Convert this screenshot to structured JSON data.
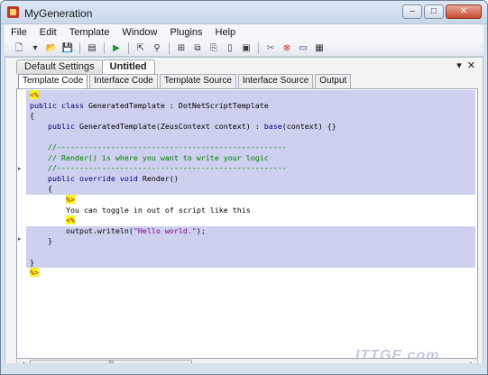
{
  "window": {
    "title": "MyGeneration",
    "min": "–",
    "max": "□",
    "close": "✕"
  },
  "menu": [
    "File",
    "Edit",
    "Template",
    "Window",
    "Plugins",
    "Help"
  ],
  "toolbar": {
    "icons": [
      "new-file-icon",
      "dropdown-arrow-icon",
      "open-folder-icon",
      "save-icon",
      "separator",
      "properties-icon",
      "separator",
      "run-icon",
      "separator",
      "open-output-icon",
      "pin-icon",
      "separator",
      "tree-icon",
      "copy-icon",
      "paste-icon",
      "document-icon",
      "code-doc-icon",
      "separator",
      "tools-icon",
      "stop-icon",
      "monitor-icon",
      "settings-doc-icon"
    ]
  },
  "doc_tabs": [
    {
      "label": "Default Settings",
      "active": false
    },
    {
      "label": "Untitled",
      "active": true
    }
  ],
  "doc_controls": {
    "dropdown": "▾",
    "close": "✕"
  },
  "sub_tabs": [
    {
      "label": "Template Code",
      "active": true
    },
    {
      "label": "Interface Code",
      "active": false
    },
    {
      "label": "Template Source",
      "active": false
    },
    {
      "label": "Interface Source",
      "active": false
    },
    {
      "label": "Output",
      "active": false
    }
  ],
  "code": [
    {
      "kind": "script",
      "parts": [
        {
          "c": "tag",
          "t": "<%"
        }
      ]
    },
    {
      "kind": "script",
      "parts": [
        {
          "c": "kw",
          "t": "public class "
        },
        {
          "c": "tx",
          "t": "GeneratedTemplate : DotNetScriptTemplate"
        }
      ]
    },
    {
      "kind": "script",
      "parts": [
        {
          "c": "tx",
          "t": "{"
        }
      ]
    },
    {
      "kind": "script",
      "parts": [
        {
          "c": "tx",
          "t": "    "
        },
        {
          "c": "kw",
          "t": "public "
        },
        {
          "c": "tx",
          "t": "GeneratedTemplate(ZeusContext context) : "
        },
        {
          "c": "kw",
          "t": "base"
        },
        {
          "c": "tx",
          "t": "(context) {}"
        }
      ]
    },
    {
      "kind": "script",
      "parts": [
        {
          "c": "tx",
          "t": ""
        }
      ]
    },
    {
      "kind": "script",
      "parts": [
        {
          "c": "cm",
          "t": "    //---------------------------------------------------"
        }
      ]
    },
    {
      "kind": "script",
      "parts": [
        {
          "c": "cm",
          "t": "    // Render() is where you want to write your logic"
        }
      ]
    },
    {
      "kind": "script",
      "parts": [
        {
          "c": "cm",
          "t": "    //---------------------------------------------------"
        }
      ]
    },
    {
      "kind": "script",
      "parts": [
        {
          "c": "tx",
          "t": "    "
        },
        {
          "c": "kw",
          "t": "public override void "
        },
        {
          "c": "tx",
          "t": "Render()"
        }
      ]
    },
    {
      "kind": "script",
      "parts": [
        {
          "c": "tx",
          "t": "    {"
        }
      ]
    },
    {
      "kind": "plain",
      "parts": [
        {
          "c": "tx",
          "t": "        "
        },
        {
          "c": "tag",
          "t": "%>"
        }
      ]
    },
    {
      "kind": "plain",
      "parts": [
        {
          "c": "tx",
          "t": "        You can toggle in out of script like this"
        }
      ]
    },
    {
      "kind": "plain",
      "parts": [
        {
          "c": "tx",
          "t": "        "
        },
        {
          "c": "tag",
          "t": "<%"
        }
      ]
    },
    {
      "kind": "script",
      "parts": [
        {
          "c": "tx",
          "t": "        output.writeln("
        },
        {
          "c": "st",
          "t": "\"Hello world.\""
        },
        {
          "c": "tx",
          "t": ");"
        }
      ]
    },
    {
      "kind": "script",
      "parts": [
        {
          "c": "tx",
          "t": "    }"
        }
      ]
    },
    {
      "kind": "script",
      "parts": [
        {
          "c": "tx",
          "t": ""
        }
      ]
    },
    {
      "kind": "script",
      "parts": [
        {
          "c": "tx",
          "t": "}"
        }
      ]
    },
    {
      "kind": "plain",
      "parts": [
        {
          "c": "tag",
          "t": "%>"
        }
      ]
    }
  ],
  "scrollbar": {
    "left": "◂",
    "right": "▸",
    "grip": "III"
  },
  "watermark": "ITTGE.com"
}
